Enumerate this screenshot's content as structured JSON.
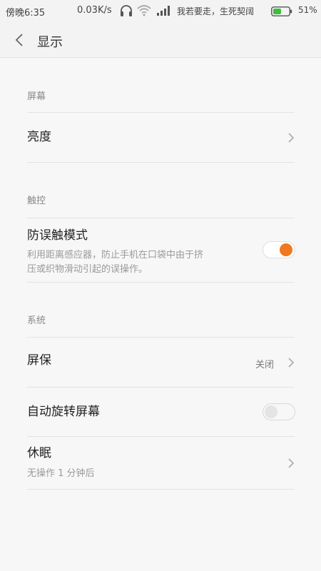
{
  "status_bar": {
    "time": "傍晚6:35",
    "net_speed": "0.03K/s",
    "carrier": "我若要走，生死契阔",
    "battery_pct": "51%",
    "battery_level": 0.51,
    "icons": [
      "headset-icon",
      "wifi-icon",
      "signal-icon",
      "battery-icon"
    ]
  },
  "header": {
    "title": "显示",
    "back_icon": "chevron-left-icon"
  },
  "sections": {
    "screen": {
      "title": "屏幕",
      "brightness": {
        "label": "亮度"
      }
    },
    "touch": {
      "title": "触控",
      "anti_mistouch": {
        "label": "防误触模式",
        "summary_line1": "利用距离感应器，防止手机在口袋中由于挤",
        "summary_line2": "压或织物滑动引起的误操作。",
        "enabled": true
      }
    },
    "system": {
      "title": "系统",
      "screensaver": {
        "label": "屏保",
        "value": "关闭"
      },
      "auto_rotate": {
        "label": "自动旋转屏幕",
        "enabled": false
      },
      "sleep": {
        "label": "休眠",
        "summary": "无操作 1 分钟后"
      }
    }
  },
  "colors": {
    "accent": "#f0781e",
    "background": "#f7f7f7",
    "divider": "#e3e3e3"
  }
}
